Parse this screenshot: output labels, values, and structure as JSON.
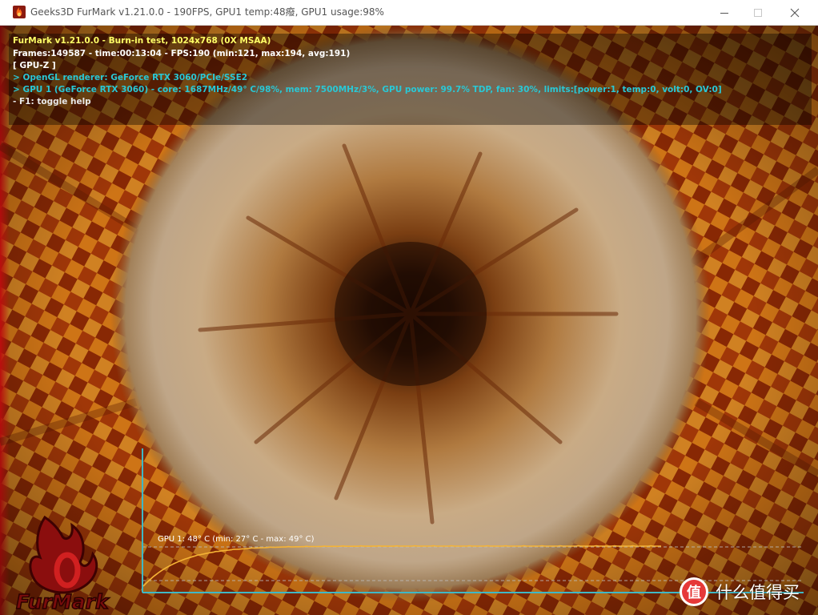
{
  "window": {
    "title": "Geeks3D FurMark v1.21.0.0 - 190FPS, GPU1 temp:48癈, GPU1 usage:98%",
    "icon": "furmark-app-icon",
    "controls": [
      "minimize-icon",
      "maximize-icon",
      "close-icon"
    ]
  },
  "osd": {
    "line1": "FurMark v1.21.0.0 - Burn-in test, 1024x768 (0X MSAA)",
    "line2": "Frames:149587 - time:00:13:04 - FPS:190 (min:121, max:194, avg:191)",
    "line3": "[ GPU-Z ]",
    "line4": "> OpenGL renderer: GeForce RTX 3060/PCIe/SSE2",
    "line5": "> GPU 1 (GeForce RTX 3060) - core: 1687MHz/49° C/98%, mem: 7500MHz/3%, GPU power: 99.7% TDP, fan: 30%, limits:[power:1, temp:0, volt:0, OV:0]",
    "line6": "- F1: toggle help",
    "colors": {
      "title": "#ffff66",
      "stats": "#ffffff",
      "info": "#29c8d6",
      "help": "#e8e8e8"
    }
  },
  "temperature_graph": {
    "label": "GPU 1: 48° C (min: 27° C - max: 49° C)",
    "current_c": 48,
    "min_c": 27,
    "max_c": 49,
    "line_color": "#f5b335",
    "axis_color": "#3fb8c6"
  },
  "logo": {
    "text": "FurMark"
  },
  "watermark": {
    "text": "什么值得买",
    "icon": "smzdm-badge-icon"
  }
}
